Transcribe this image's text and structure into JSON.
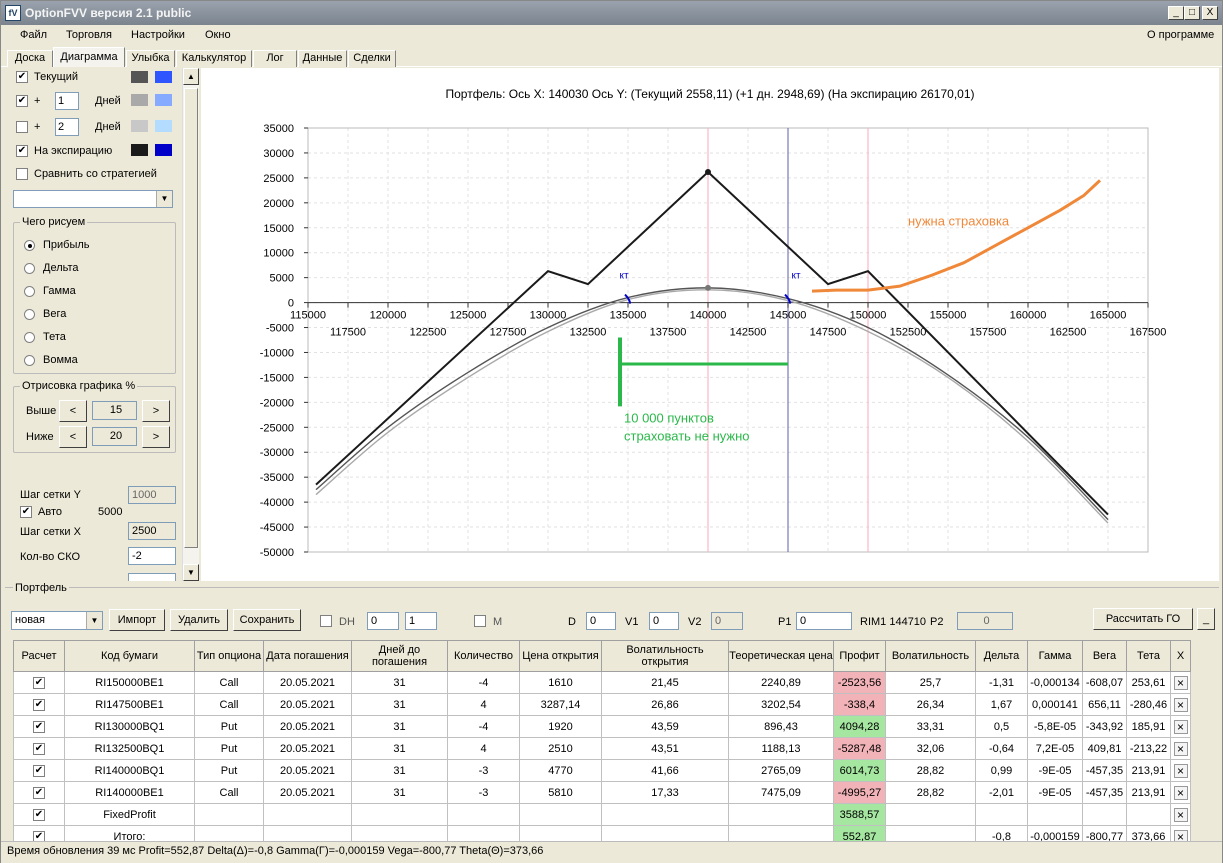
{
  "window": {
    "title": "OptionFVV версия 2.1 public",
    "icon": "app-icon",
    "buttons": [
      "_",
      "□",
      "X"
    ]
  },
  "menu": {
    "items": [
      "Файл",
      "Торговля",
      "Настройки",
      "Окно"
    ],
    "about": "О программе"
  },
  "tabs": [
    "Доска",
    "Диаграмма",
    "Улыбка",
    "Калькулятор",
    "Лог",
    "Данные",
    "Сделки"
  ],
  "left": {
    "current": {
      "label": "Текущий",
      "checked": true,
      "c1": "#555555",
      "c2": "#2f55ff"
    },
    "plus1": {
      "plus": "+",
      "value": "1",
      "unit": "Дней",
      "checked": true,
      "c1": "#a9a9a9",
      "c2": "#85aaff"
    },
    "plus2": {
      "plus": "+",
      "value": "2",
      "unit": "Дней",
      "checked": false,
      "c1": "#c8c8c8",
      "c2": "#b4dcff"
    },
    "expiry": {
      "label": "На экспирацию",
      "checked": true,
      "c1": "#1a1a1a",
      "c2": "#0000c8"
    },
    "compare": {
      "label": "Сравнить со стратегией",
      "checked": false
    },
    "what_title": "Чего рисуем",
    "what": [
      "Прибыль",
      "Дельта",
      "Гамма",
      "Вега",
      "Тета",
      "Вомма"
    ],
    "draw_title": "Отрисовка графика %",
    "above": {
      "label": "Выше",
      "value": "15",
      "dec": "<",
      "inc": ">"
    },
    "below": {
      "label": "Ниже",
      "value": "20",
      "dec": "<",
      "inc": ">"
    },
    "gridY": {
      "label": "Шаг сетки Y",
      "value": "1000"
    },
    "auto": {
      "label": "Авто",
      "value": "5000",
      "checked": true
    },
    "gridX": {
      "label": "Шаг сетки X",
      "value": "2500"
    },
    "sko": {
      "label": "Кол-во СКО",
      "value": "-2"
    },
    "scroll": {
      "up": "▲",
      "down": "▼"
    }
  },
  "chart_data": {
    "type": "line",
    "title": "Портфель: Ось X: 140030 Ось Y:  (Текущий 2558,11)  (+1 дн. 2948,69)  (На экспирацию 26170,01)",
    "xlim": [
      115000,
      167500
    ],
    "ylim": [
      -50000,
      35000
    ],
    "x_ticks_upper": [
      115000,
      120000,
      125000,
      130000,
      135000,
      140000,
      145000,
      150000,
      155000,
      160000,
      165000
    ],
    "x_ticks_lower": [
      117500,
      122500,
      127500,
      132500,
      137500,
      142500,
      147500,
      152500,
      157500,
      162500,
      167500
    ],
    "y_ticks": [
      35000,
      30000,
      25000,
      20000,
      15000,
      10000,
      5000,
      0,
      -5000,
      -10000,
      -15000,
      -20000,
      -25000,
      -30000,
      -35000,
      -40000,
      -45000,
      -50000
    ],
    "grid": true,
    "series": [
      {
        "color": "#1a1a1a",
        "x": [
          115500,
          130000,
          132500,
          140000,
          147500,
          150000,
          165000
        ],
        "y": [
          -36500,
          6300,
          3700,
          26170,
          3700,
          6300,
          -42500
        ]
      },
      {
        "color": "#555555",
        "x": [
          115500,
          120000,
          125000,
          130000,
          135000,
          140000,
          145000,
          150000,
          155000,
          160000,
          165000
        ],
        "y": [
          -37500,
          -25000,
          -14000,
          -5000,
          1000,
          2950,
          800,
          -5000,
          -14500,
          -27000,
          -43500
        ]
      },
      {
        "color": "#a9a9a9",
        "x": [
          115500,
          120000,
          125000,
          130000,
          135000,
          140000,
          145000,
          150000,
          155000,
          160000,
          165000
        ],
        "y": [
          -38500,
          -26000,
          -15000,
          -5800,
          600,
          2560,
          400,
          -5800,
          -15000,
          -27800,
          -44200
        ]
      }
    ],
    "vlines": [
      {
        "x": 140000,
        "color": "#ffb6c8"
      },
      {
        "x": 145000,
        "color": "#7a7ab8"
      },
      {
        "x": 150000,
        "color": "#ffb6c8"
      }
    ],
    "kt_labels": [
      {
        "text": "кт",
        "x": 135000
      },
      {
        "text": "кт",
        "x": 145000
      }
    ],
    "annotations": [
      {
        "text": "нужна страховка",
        "color": "#f0883a"
      },
      {
        "text": "10 000 пунктов",
        "color": "#2bb84a"
      },
      {
        "text": "страховать не нужно",
        "color": "#2bb84a"
      }
    ],
    "orange_curve": {
      "x": [
        146500,
        148000,
        150000,
        152000,
        154000,
        156000,
        158000,
        160000,
        162000,
        163500,
        164500
      ],
      "y": [
        2300,
        2500,
        2500,
        3300,
        5500,
        8000,
        11500,
        15000,
        18500,
        21500,
        24500
      ]
    },
    "green_bracket": {
      "x_from": 134500,
      "x_to": 145000,
      "y_bar": -12300,
      "y_top": -7000,
      "y_bottom": -20800
    }
  },
  "portfolio": {
    "label": "Портфель",
    "select_value": "новая",
    "import": "Импорт",
    "delete": "Удалить",
    "save": "Сохранить",
    "dh": "DH",
    "dh_v1": "0",
    "dh_v2": "1",
    "m": "M",
    "d_label": "D",
    "d_val": "0",
    "v1_label": "V1",
    "v1_val": "0",
    "v2_label": "V2",
    "v2_val": "0",
    "p1_label": "P1",
    "p1_val": "0",
    "rim": "RIM1 144710",
    "p2_label": "P2",
    "p2_val": "0",
    "calc": "Рассчитать ГО",
    "min": "_",
    "columns": [
      "Расчет",
      "Код бумаги",
      "Тип опциона",
      "Дата погашения",
      "Дней до погашения",
      "Количество",
      "Цена открытия",
      "Волатильность открытия",
      "Теоретическая цена",
      "Профит",
      "Волатильность",
      "Дельта",
      "Гамма",
      "Вега",
      "Тета",
      "X"
    ],
    "rows": [
      {
        "code": "RI150000BE1",
        "type": "Call",
        "date": "20.05.2021",
        "days": "31",
        "qty": "-4",
        "price": "1610",
        "vol_open": "21,45",
        "theo": "2240,89",
        "profit": "-2523,56",
        "neg": true,
        "vol": "25,7",
        "delta": "-1,31",
        "gamma": "-0,000134",
        "vega": "-608,07",
        "theta": "253,61"
      },
      {
        "code": "RI147500BE1",
        "type": "Call",
        "date": "20.05.2021",
        "days": "31",
        "qty": "4",
        "price": "3287,14",
        "vol_open": "26,86",
        "theo": "3202,54",
        "profit": "-338,4",
        "neg": true,
        "vol": "26,34",
        "delta": "1,67",
        "gamma": "0,000141",
        "vega": "656,11",
        "theta": "-280,46"
      },
      {
        "code": "RI130000BQ1",
        "type": "Put",
        "date": "20.05.2021",
        "days": "31",
        "qty": "-4",
        "price": "1920",
        "vol_open": "43,59",
        "theo": "896,43",
        "profit": "4094,28",
        "neg": false,
        "vol": "33,31",
        "delta": "0,5",
        "gamma": "-5,8E-05",
        "vega": "-343,92",
        "theta": "185,91"
      },
      {
        "code": "RI132500BQ1",
        "type": "Put",
        "date": "20.05.2021",
        "days": "31",
        "qty": "4",
        "price": "2510",
        "vol_open": "43,51",
        "theo": "1188,13",
        "profit": "-5287,48",
        "neg": true,
        "vol": "32,06",
        "delta": "-0,64",
        "gamma": "7,2E-05",
        "vega": "409,81",
        "theta": "-213,22"
      },
      {
        "code": "RI140000BQ1",
        "type": "Put",
        "date": "20.05.2021",
        "days": "31",
        "qty": "-3",
        "price": "4770",
        "vol_open": "41,66",
        "theo": "2765,09",
        "profit": "6014,73",
        "neg": false,
        "vol": "28,82",
        "delta": "0,99",
        "gamma": "-9E-05",
        "vega": "-457,35",
        "theta": "213,91"
      },
      {
        "code": "RI140000BE1",
        "type": "Call",
        "date": "20.05.2021",
        "days": "31",
        "qty": "-3",
        "price": "5810",
        "vol_open": "17,33",
        "theo": "7475,09",
        "profit": "-4995,27",
        "neg": true,
        "vol": "28,82",
        "delta": "-2,01",
        "gamma": "-9E-05",
        "vega": "-457,35",
        "theta": "213,91"
      },
      {
        "code": "FixedProfit",
        "type": "",
        "date": "",
        "days": "",
        "qty": "",
        "price": "",
        "vol_open": "",
        "theo": "",
        "profit": "3588,57",
        "neg": false,
        "vol": "",
        "delta": "",
        "gamma": "",
        "vega": "",
        "theta": ""
      },
      {
        "code": "Итого:",
        "type": "",
        "date": "",
        "days": "",
        "qty": "",
        "price": "",
        "vol_open": "",
        "theo": "",
        "profit": "552,87",
        "neg": false,
        "vol": "",
        "delta": "-0,8",
        "gamma": "-0,000159",
        "vega": "-800,77",
        "theta": "373,66",
        "total": true
      }
    ]
  },
  "status": "Время обновления 39 мс  Profit=552,87 Delta(Δ)=-0,8 Gamma(Γ)=-0,000159 Vega=-800,77 Theta(Θ)=373,66"
}
